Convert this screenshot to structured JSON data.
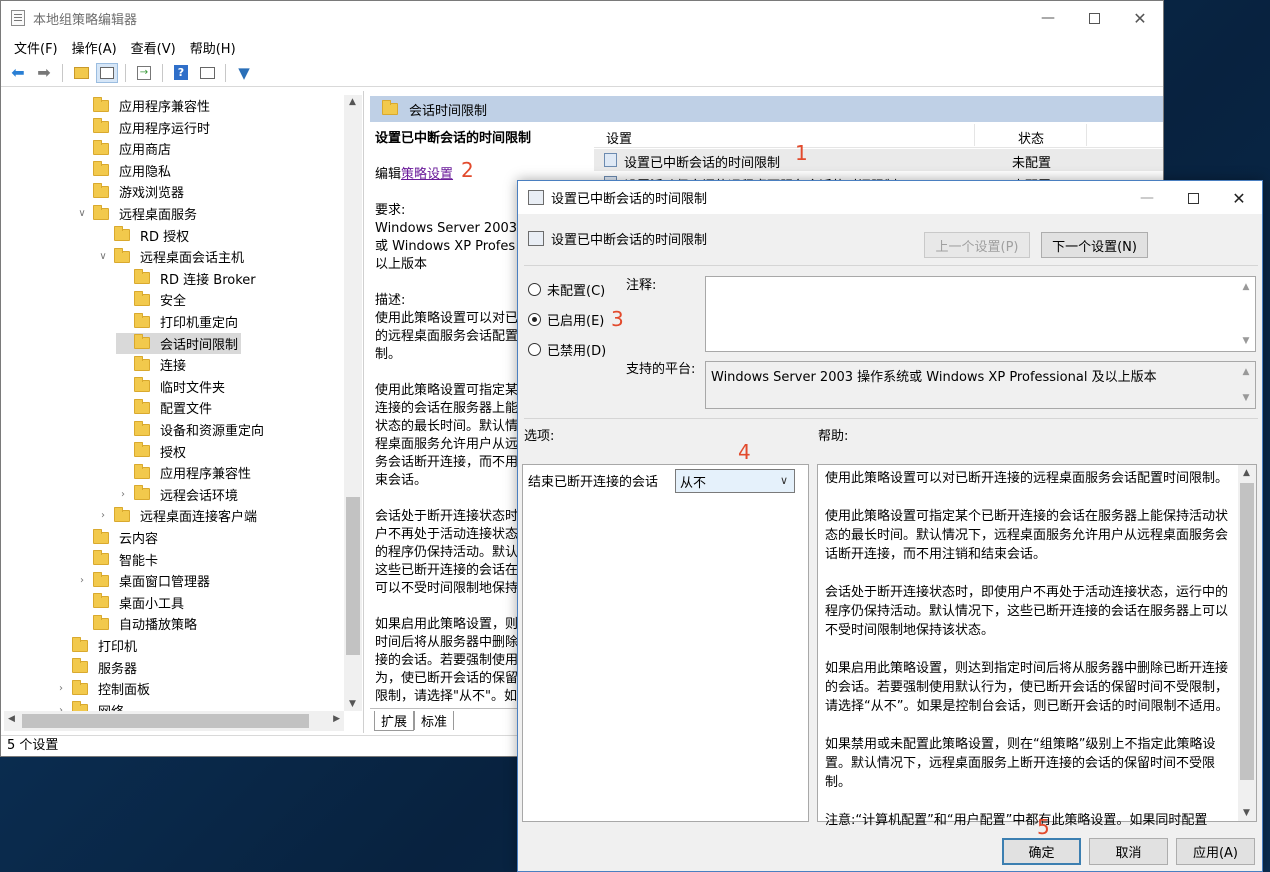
{
  "main_window": {
    "title": "本地组策略编辑器",
    "menu": [
      "文件(F)",
      "操作(A)",
      "查看(V)",
      "帮助(H)"
    ],
    "status": "5 个设置"
  },
  "tree": [
    {
      "label": "应用程序兼容性",
      "level": 0,
      "chevron": ""
    },
    {
      "label": "应用程序运行时",
      "level": 0,
      "chevron": ""
    },
    {
      "label": "应用商店",
      "level": 0,
      "chevron": ""
    },
    {
      "label": "应用隐私",
      "level": 0,
      "chevron": ""
    },
    {
      "label": "游戏浏览器",
      "level": 0,
      "chevron": ""
    },
    {
      "label": "远程桌面服务",
      "level": 0,
      "chevron": "expanded"
    },
    {
      "label": "RD 授权",
      "level": 1,
      "chevron": ""
    },
    {
      "label": "远程桌面会话主机",
      "level": 1,
      "chevron": "expanded"
    },
    {
      "label": "RD 连接 Broker",
      "level": 2,
      "chevron": ""
    },
    {
      "label": "安全",
      "level": 2,
      "chevron": ""
    },
    {
      "label": "打印机重定向",
      "level": 2,
      "chevron": ""
    },
    {
      "label": "会话时间限制",
      "level": 2,
      "chevron": "",
      "selected": true
    },
    {
      "label": "连接",
      "level": 2,
      "chevron": ""
    },
    {
      "label": "临时文件夹",
      "level": 2,
      "chevron": ""
    },
    {
      "label": "配置文件",
      "level": 2,
      "chevron": ""
    },
    {
      "label": "设备和资源重定向",
      "level": 2,
      "chevron": ""
    },
    {
      "label": "授权",
      "level": 2,
      "chevron": ""
    },
    {
      "label": "应用程序兼容性",
      "level": 2,
      "chevron": ""
    },
    {
      "label": "远程会话环境",
      "level": 2,
      "chevron": "collapsed"
    },
    {
      "label": "远程桌面连接客户端",
      "level": 1,
      "chevron": "collapsed"
    },
    {
      "label": "云内容",
      "level": 0,
      "chevron": ""
    },
    {
      "label": "智能卡",
      "level": 0,
      "chevron": ""
    },
    {
      "label": "桌面窗口管理器",
      "level": 0,
      "chevron": "collapsed"
    },
    {
      "label": "桌面小工具",
      "level": 0,
      "chevron": ""
    },
    {
      "label": "自动播放策略",
      "level": 0,
      "chevron": ""
    },
    {
      "label": "打印机",
      "level": -1,
      "chevron": ""
    },
    {
      "label": "服务器",
      "level": -1,
      "chevron": ""
    },
    {
      "label": "控制面板",
      "level": -1,
      "chevron": "collapsed"
    },
    {
      "label": "网络",
      "level": -1,
      "chevron": "collapsed"
    }
  ],
  "right_panel": {
    "header": "会话时间限制",
    "desc_title": "设置已中断会话的时间限制",
    "edit_prefix": "编辑",
    "edit_link": "策略设置",
    "desc_lines": [
      "要求:",
      "Windows Server 2003 :",
      "或 Windows XP Profes",
      "以上版本",
      "",
      "描述:",
      "使用此策略设置可以对已",
      "的远程桌面服务会话配置",
      "制。",
      "",
      "使用此策略设置可指定某",
      "连接的会话在服务器上能",
      "状态的最长时间。默认情",
      "程桌面服务允许用户从远",
      "务会话断开连接，而不用",
      "束会话。",
      "",
      "会话处于断开连接状态时",
      "户不再处于活动连接状态",
      "的程序仍保持活动。默认",
      "这些已断开连接的会话在",
      "可以不受时间限制地保持",
      "",
      "如果启用此策略设置，则",
      "时间后将从服务器中删除",
      "接的会话。若要强制使用",
      "为，使已断开会话的保留",
      "限制，请选择\"从不\"。如"
    ],
    "tabs": [
      "扩展",
      "标准"
    ],
    "list_headers": {
      "setting": "设置",
      "state": "状态"
    },
    "list_rows": [
      {
        "name": "设置已中断会话的时间限制",
        "state": "未配置"
      },
      {
        "name": "设置活动但空闲的远程桌面服务会话的时间限制",
        "state": "未配置"
      }
    ]
  },
  "dialog": {
    "title": "设置已中断会话的时间限制",
    "subtitle": "设置已中断会话的时间限制",
    "prev_btn": "上一个设置(P)",
    "next_btn": "下一个设置(N)",
    "radios": [
      {
        "label": "未配置(C)",
        "checked": false
      },
      {
        "label": "已启用(E)",
        "checked": true
      },
      {
        "label": "已禁用(D)",
        "checked": false
      }
    ],
    "comment_label": "注释:",
    "platform_label": "支持的平台:",
    "platform_text": "Windows Server 2003 操作系统或 Windows XP Professional 及以上版本",
    "options_label": "选项:",
    "help_label": "帮助:",
    "option_name": "结束已断开连接的会话",
    "option_value": "从不",
    "help_paragraphs": [
      "使用此策略设置可以对已断开连接的远程桌面服务会话配置时间限制。",
      "使用此策略设置可指定某个已断开连接的会话在服务器上能保持活动状态的最长时间。默认情况下，远程桌面服务允许用户从远程桌面服务会话断开连接，而不用注销和结束会话。",
      "会话处于断开连接状态时，即使用户不再处于活动连接状态，运行中的程序仍保持活动。默认情况下，这些已断开连接的会话在服务器上可以不受时间限制地保持该状态。",
      "如果启用此策略设置，则达到指定时间后将从服务器中删除已断开连接的会话。若要强制使用默认行为，使已断开会话的保留时间不受限制，请选择“从不”。如果是控制台会话，则已断开会话的时间限制不适用。",
      "如果禁用或未配置此策略设置，则在“组策略”级别上不指定此策略设置。默认情况下，远程桌面服务上断开连接的会话的保留时间不受限制。",
      "注意:“计算机配置”和“用户配置”中都有此策略设置。如果同时配置"
    ],
    "ok": "确定",
    "cancel": "取消",
    "apply": "应用(A)"
  },
  "step_marks": [
    "1",
    "2",
    "3",
    "4",
    "5"
  ],
  "colors": {
    "header_blue": "#bfd0e6",
    "accent": "#e24a2c",
    "link": "#6a1b9a"
  }
}
